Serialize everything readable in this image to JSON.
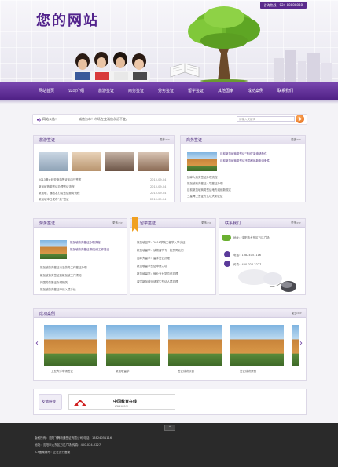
{
  "header": {
    "logo": "您的网站",
    "hotline": "咨询热线：024-88888888"
  },
  "nav": [
    "网站首页",
    "公司介绍",
    "旅游签证",
    "商务签证",
    "劳务签证",
    "留学签证",
    "其他国家",
    "成功案例",
    "联系我们"
  ],
  "notice": {
    "label": "网站公告：",
    "message": "诚信为本！市场在变诚信永远不变。",
    "search_placeholder": "请输入关键词"
  },
  "travel": {
    "title": "旅游签证",
    "more": "更多>>",
    "items": [
      {
        "text": "2013澳大利亚旅游签证年内只签发",
        "date": "2013-09-04"
      },
      {
        "text": "新加坡旅游签证办理签证流程",
        "date": "2013-09-04"
      },
      {
        "text": "新加坡、通出发打赏签证服务流程",
        "date": "2013-09-04"
      },
      {
        "text": "新加坡本日发布“美”签证",
        "date": "2013-09-04"
      }
    ]
  },
  "business": {
    "title": "商务签证",
    "more": "更多>>",
    "items": [
      "目前新加坡商务签证“赞可”新申请条件",
      "目前新加坡商务签证不同移民新申请条件",
      "加拿大商务签证办理流程",
      "新加坡商务签证人境签证办理",
      "目前新加坡商务签证地方组织新规定",
      "三星海上签证方式以大到证证"
    ]
  },
  "labor": {
    "title": "劳务签证",
    "more": "更多>>",
    "items": [
      "新加坡劳务签证办理流程",
      "新加坡劳务签证 新加坡工作签证",
      "新加坡劳务签证以及劳务工作签证办理",
      "新加坡劳务签证到新加坡工作须知",
      "外国劳务签证办理相关",
      "新加坡劳务签证申请入境手续"
    ]
  },
  "study": {
    "title": "留学签证",
    "more": "更多>>",
    "items": [
      "新加坡留学：2016学院工程学入学认证",
      "新加坡留学：读物留学专一批赞同北门",
      "加拿大留学：留学签证办理",
      "新加坡留学签证申请入境",
      "新加坡留学：就业专业学位证办理",
      "留学新加坡申请学生签证人境办理"
    ]
  },
  "contact": {
    "title": "联系我们",
    "more": "更多>>",
    "lines": [
      "地址：沈阳市大东区万达广场",
      "电话：13824051116",
      "传真：400-024-2227"
    ]
  },
  "cases": {
    "title": "成功案例",
    "more": "更多>>",
    "captions": [
      "工业大学申请签证",
      "新加坡留学",
      "签证成功项目",
      "签证成功案例"
    ]
  },
  "links": {
    "title": "友情链接",
    "partner": "中国教育在线",
    "partner_sub": "www.eol.cn"
  },
  "footer": {
    "up": "^",
    "line1": "版权所有：沈阳飞腾新通签证有限公司    电话：13824051116",
    "line2": "地址：沈阳市大东区万达广场    传真：400-024-2227",
    "line3": "ICP备案编号：正在进行备案"
  }
}
